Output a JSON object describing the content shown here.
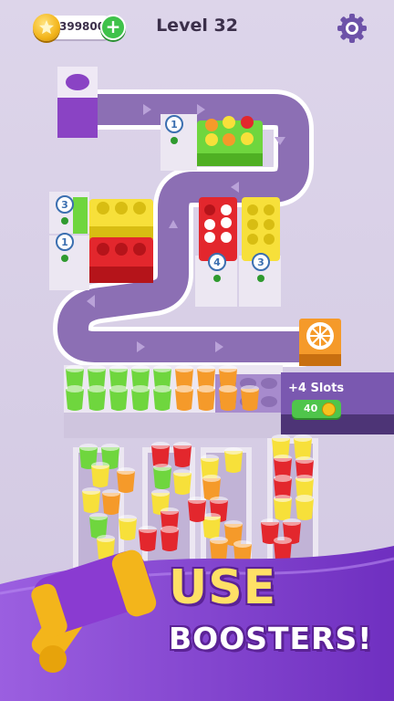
{
  "header": {
    "coins": "399800",
    "add_coins_symbol": "+",
    "level": "Level 32",
    "settings_icon": "gear-icon",
    "coin_icon": "star-coin-icon"
  },
  "board": {
    "tray_badges": [
      "1",
      "3",
      "1",
      "4",
      "3"
    ],
    "exit_icon": "orange-slice-icon"
  },
  "slots": {
    "label": "+4 Slots",
    "price": "40"
  },
  "promo": {
    "line1": "USE",
    "line2": "BOOSTERS!",
    "icon": "hammer-icon"
  },
  "colors": {
    "background": "#d8cfe6",
    "path": "#8c6fb4",
    "green": "#6fd63e",
    "orange": "#f59a2a",
    "red": "#e3272d",
    "yellow": "#f7e03a",
    "accent_purple": "#7a3fc2"
  }
}
